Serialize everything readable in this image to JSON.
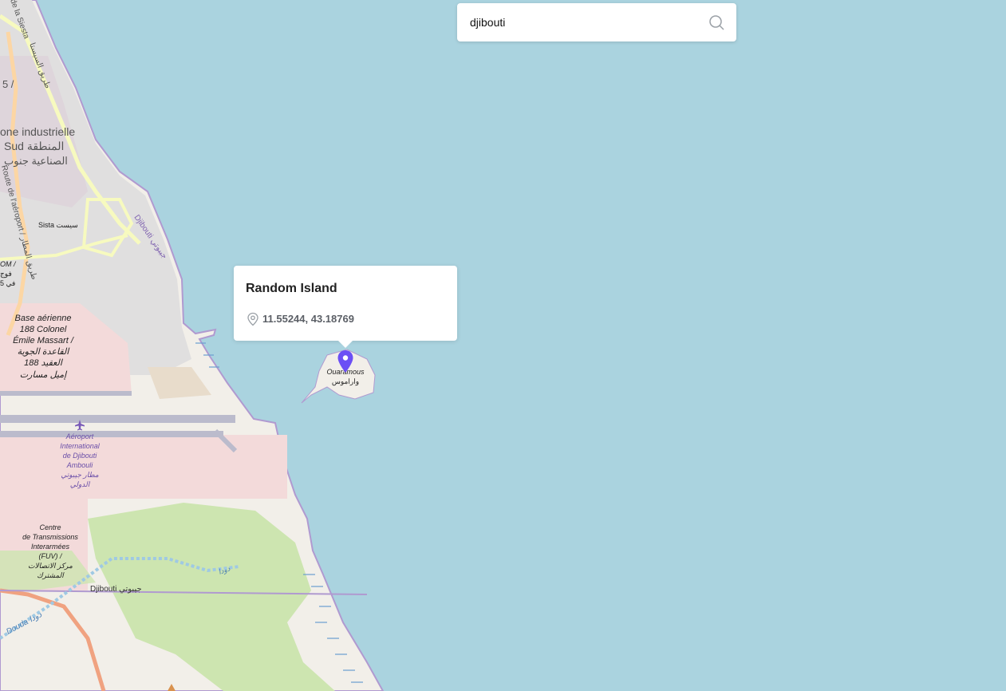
{
  "search": {
    "value": "djibouti",
    "icon": "search-icon"
  },
  "popup": {
    "title": "Random Island",
    "coords": "11.55244, 43.18769",
    "icon": "location-pin-icon"
  },
  "marker": {
    "icon": "map-marker-icon",
    "color": "#6b4ff5"
  },
  "colors": {
    "water": "#aad3df",
    "land": "#f2efe9",
    "urban": "#e0dfdf",
    "military": "#f3dada",
    "grass": "#cde5b0",
    "primary_road": "#fcd6a4",
    "secondary_road": "#f7fabf",
    "boundary": "#b09ad0"
  },
  "map_labels": {
    "siesta": "de la Siesta",
    "siesta_ar": "طريق السيستا",
    "zone_industrielle": "one industrielle",
    "sud": "Sud المنطقة",
    "sud_ar": "الصناعية جنوب",
    "route_aeroport": "Route de l'aéroport / طريق المطار",
    "sista": "Sista سيست",
    "djibouti_coast": "Djibouti جيبوتي",
    "r5": "r 5 /",
    "om": "OM /",
    "fouj": "فوج",
    "n5": "5 في",
    "base1": "Base aérienne",
    "base2": "188 Colonel",
    "base3": "Émile Massart /",
    "base4": "القاعدة الجوية",
    "base5": "188 العقيد",
    "base6": "إميل مسارت",
    "aero1": "Aéroport",
    "aero2": "International",
    "aero3": "de Djibouti",
    "aero4": "Ambouli",
    "aero5": "مطار جيبوتي",
    "aero6": "الدولي",
    "ctr1": "Centre",
    "ctr2": "de Transmissions",
    "ctr3": "Interarmées",
    "ctr4": "(FUV) /",
    "ctr5": "مركز الاتصالات",
    "ctr6": "المشترك",
    "djibouti_city": "Djibouti جيبوتي",
    "douda": "Douda دودا",
    "douda2": "دودا",
    "ouaramous": "Ouaramous",
    "ouaramous_ar": "واراموس"
  }
}
